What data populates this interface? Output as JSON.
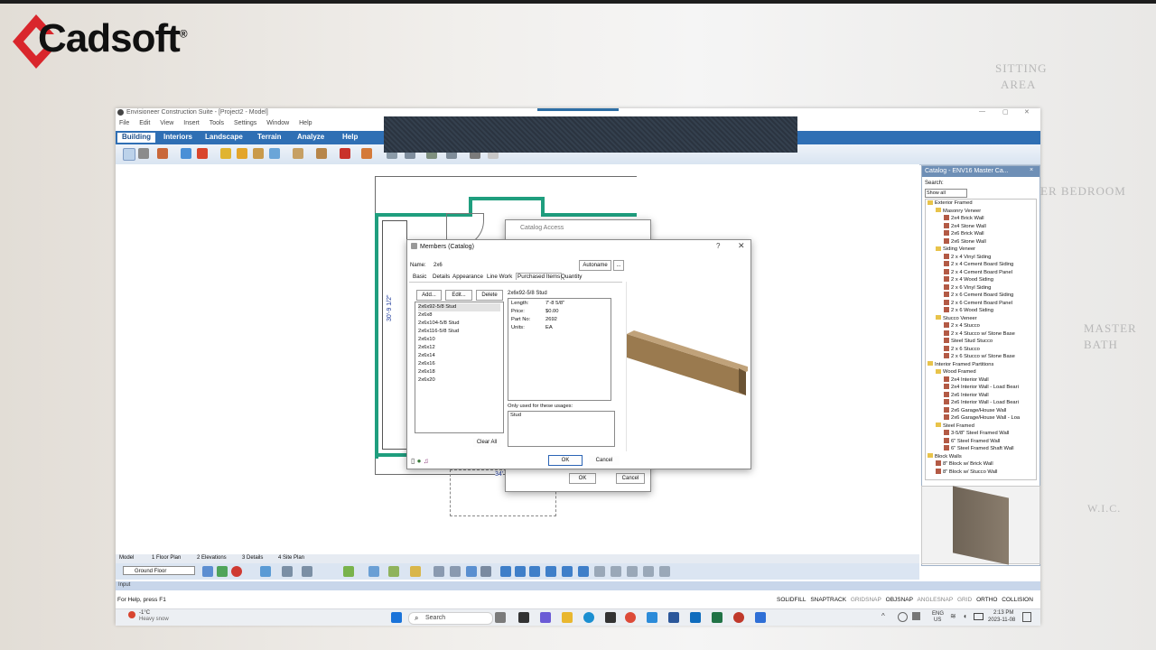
{
  "brand": {
    "name": "Cadsoft",
    "registered": "®"
  },
  "background": {
    "labels": [
      "SITTING",
      "AREA",
      "ER BEDROOM",
      "MASTER",
      "BATH",
      "W.I.C."
    ]
  },
  "window": {
    "title": "Envisioneer Construction Suite - [Project2 - Model]",
    "menu": [
      "File",
      "Edit",
      "View",
      "Insert",
      "Tools",
      "Settings",
      "Window",
      "Help"
    ],
    "ribbon_tabs": [
      "Building",
      "Interiors",
      "Landscape",
      "Terrain",
      "Analyze",
      "Help"
    ],
    "active_tab": "Building",
    "accent": "#2f6fb4"
  },
  "plan": {
    "dim_vertical": "30'-9 1/2\"",
    "dim_bottom": "34'"
  },
  "catalog_access": {
    "title": "Catalog Access",
    "ok": "OK",
    "cancel": "Cancel"
  },
  "members": {
    "title": "Members (Catalog)",
    "name_label": "Name:",
    "name_value": "2x6",
    "autoname": "Autoname",
    "ellipsis": "...",
    "tabs": [
      "Basic",
      "Details",
      "Appearance",
      "Line Work",
      "Purchased Items",
      "Quantity"
    ],
    "active_tab": "Purchased Items",
    "add": "Add...",
    "edit": "Edit...",
    "delete": "Delete",
    "items": [
      "2x6x92-5/8 Stud",
      "2x6x8",
      "2x6x104-5/8 Stud",
      "2x6x116-5/8 Stud",
      "2x6x10",
      "2x6x12",
      "2x6x14",
      "2x6x16",
      "2x6x18",
      "2x6x20"
    ],
    "selected_item": "2x6x92-5/8 Stud",
    "clear_all": "Clear All",
    "detail_title": "2x6x92-5/8 Stud",
    "details": [
      {
        "k": "Length:",
        "v": "7'-8 5/8\""
      },
      {
        "k": "Price:",
        "v": "$0.00"
      },
      {
        "k": "Part No:",
        "v": "2692"
      },
      {
        "k": "Units:",
        "v": "EA"
      }
    ],
    "usage_label": "Only used for these usages:",
    "usage_value": "Stud",
    "ok": "OK",
    "cancel": "Cancel"
  },
  "catalog_panel": {
    "title": "Catalog - ENV16 Master Ca...",
    "search_label": "Search:",
    "filter": "Show all",
    "tree": [
      {
        "lvl": 0,
        "t": "Exterior Framed",
        "f": 1
      },
      {
        "lvl": 1,
        "t": "Masonry Veneer",
        "f": 1
      },
      {
        "lvl": 2,
        "t": "2x4 Brick Wall"
      },
      {
        "lvl": 2,
        "t": "2x4 Stone Wall"
      },
      {
        "lvl": 2,
        "t": "2x6 Brick Wall"
      },
      {
        "lvl": 2,
        "t": "2x6 Stone Wall"
      },
      {
        "lvl": 1,
        "t": "Siding Veneer",
        "f": 1
      },
      {
        "lvl": 2,
        "t": "2 x 4 Vinyl Siding"
      },
      {
        "lvl": 2,
        "t": "2 x 4 Cement Board Siding"
      },
      {
        "lvl": 2,
        "t": "2 x 4 Cement Board Panel"
      },
      {
        "lvl": 2,
        "t": "2 x 4 Wood Siding"
      },
      {
        "lvl": 2,
        "t": "2 x 6 Vinyl Siding"
      },
      {
        "lvl": 2,
        "t": "2 x 6 Cement Board Siding"
      },
      {
        "lvl": 2,
        "t": "2 x 6 Cement Board Panel"
      },
      {
        "lvl": 2,
        "t": "2 x 6 Wood Siding"
      },
      {
        "lvl": 1,
        "t": "Stucco Veneer",
        "f": 1
      },
      {
        "lvl": 2,
        "t": "2 x 4 Stucco"
      },
      {
        "lvl": 2,
        "t": "2 x 4 Stucco w/ Stone Base"
      },
      {
        "lvl": 2,
        "t": "Steel Stud Stucco"
      },
      {
        "lvl": 2,
        "t": "2 x 6 Stucco"
      },
      {
        "lvl": 2,
        "t": "2 x 6 Stucco w/ Stone Base"
      },
      {
        "lvl": 0,
        "t": "Interior Framed Partitions",
        "f": 1
      },
      {
        "lvl": 1,
        "t": "Wood Framed",
        "f": 1
      },
      {
        "lvl": 2,
        "t": "2x4 Interior Wall"
      },
      {
        "lvl": 2,
        "t": "2x4 Interior Wall - Load Beari"
      },
      {
        "lvl": 2,
        "t": "2x6 Interior Wall"
      },
      {
        "lvl": 2,
        "t": "2x6 Interior Wall - Load Beari"
      },
      {
        "lvl": 2,
        "t": "2x6 Garage/House Wall"
      },
      {
        "lvl": 2,
        "t": "2x6 Garage/House Wall - Loa"
      },
      {
        "lvl": 1,
        "t": "Steel Framed",
        "f": 1
      },
      {
        "lvl": 2,
        "t": "3-5/8\" Steel Framed Wall"
      },
      {
        "lvl": 2,
        "t": "6\" Steel Framed Wall"
      },
      {
        "lvl": 2,
        "t": "6\" Steel Framed Shaft Wall"
      },
      {
        "lvl": 0,
        "t": "Block Walls",
        "f": 1
      },
      {
        "lvl": 1,
        "t": "8\" Block w/ Brick Wall"
      },
      {
        "lvl": 1,
        "t": "8\" Block w/ Stucco Wall"
      }
    ]
  },
  "bottom": {
    "view_tabs": [
      "Model",
      "1 Floor Plan",
      "2 Elevations",
      "3 Details",
      "4 Site Plan"
    ],
    "floor": "Ground Floor",
    "input_label": "Input",
    "help": "For Help, press F1",
    "status": [
      "SOLIDFILL",
      "SNAPTRACK",
      "GRIDSNAP",
      "OBJSNAP",
      "ANGLESNAP",
      "GRID",
      "ORTHO",
      "COLLISION"
    ]
  },
  "taskbar": {
    "weather_temp": "-1°C",
    "weather_desc": "Heavy snow",
    "search": "Search",
    "lang1": "ENG",
    "lang2": "US",
    "time": "2:13 PM",
    "date": "2023-11-08"
  }
}
